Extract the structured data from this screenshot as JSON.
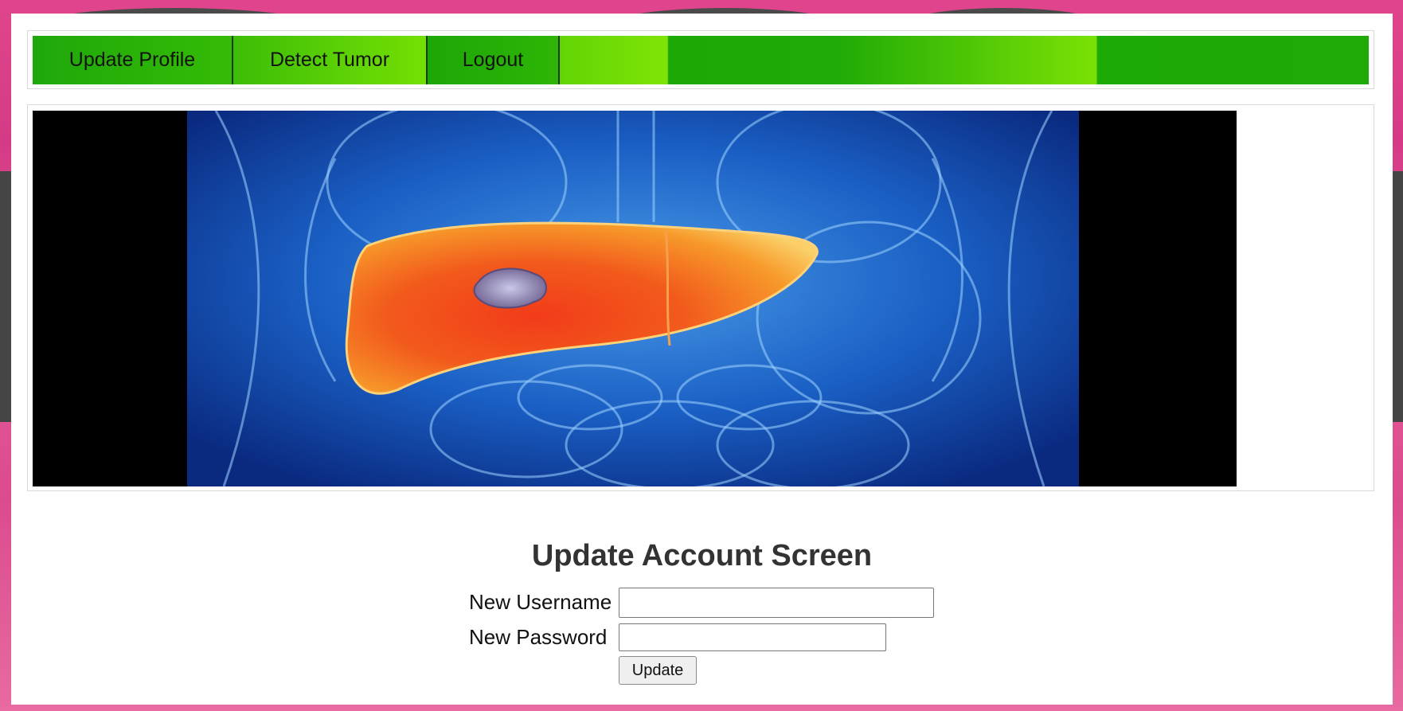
{
  "nav": {
    "items": [
      {
        "label": "Update Profile"
      },
      {
        "label": "Detect Tumor"
      },
      {
        "label": "Logout"
      }
    ]
  },
  "hero": {
    "image_subject": "liver-tumor-anatomy-illustration"
  },
  "form": {
    "title": "Update Account Screen",
    "username_label": "New Username",
    "username_value": "",
    "password_label": "New Password",
    "password_value": "",
    "submit_label": "Update"
  },
  "colors": {
    "nav_green": "#1ea80a",
    "nav_light_green": "#7ee405",
    "background_pink": "#e0458c"
  }
}
